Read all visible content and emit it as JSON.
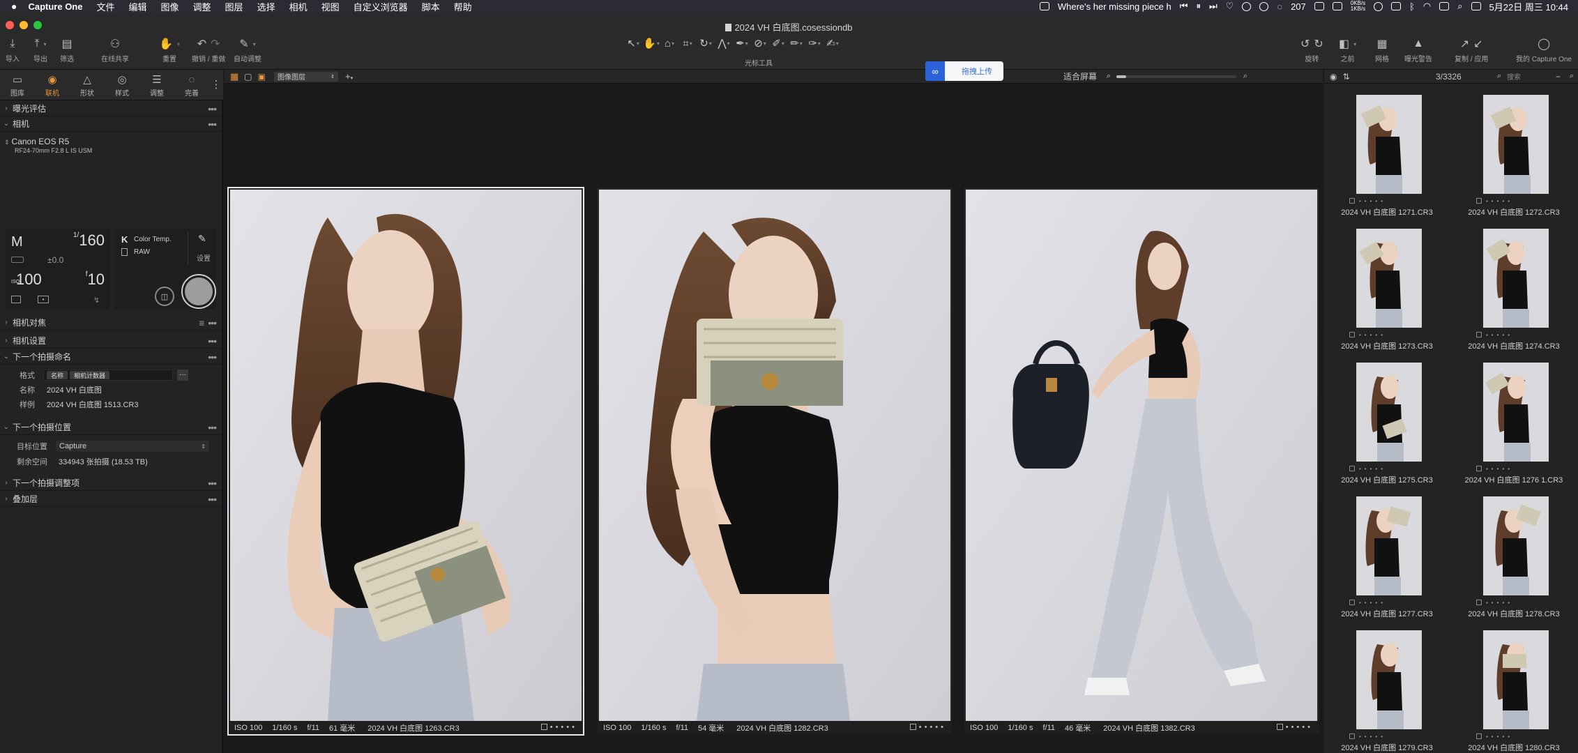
{
  "menubar": {
    "app_name": "Capture One",
    "items": [
      "文件",
      "编辑",
      "图像",
      "调整",
      "图层",
      "选择",
      "相机",
      "视图",
      "自定义浏览器",
      "脚本",
      "帮助"
    ],
    "now_playing": "Where's her missing piece h",
    "notif_count": "207",
    "net_up": "0KB/s",
    "net_down": "1KB/s",
    "datetime": "5月22日 周三  10:44"
  },
  "window": {
    "title": "2024 VH 白底图.cosessiondb"
  },
  "toolbar": {
    "import": "导入",
    "export": "导出",
    "filter": "筛选",
    "share": "在线共享",
    "reset": "重置",
    "undo_redo": "撤销 / 重做",
    "auto_adjust": "自动调整",
    "cursor_tools": "光标工具",
    "rotate": "旋转",
    "before": "之前",
    "grid": "网格",
    "exposure_warning": "曝光警告",
    "copy_apply": "复制 / 应用",
    "my_capture_one": "我的 Capture One"
  },
  "upload": {
    "label": "拖拽上传"
  },
  "left_tabs": [
    {
      "label": "图库",
      "icon": "folder-icon"
    },
    {
      "label": "联机",
      "icon": "camera-icon"
    },
    {
      "label": "形状",
      "icon": "shape-icon"
    },
    {
      "label": "样式",
      "icon": "style-icon"
    },
    {
      "label": "调整",
      "icon": "sliders-icon"
    },
    {
      "label": "完善",
      "icon": "refine-icon"
    }
  ],
  "sections": {
    "exposure_eval": "曝光评估",
    "camera": "相机",
    "camera_focus": "相机对焦",
    "camera_settings": "相机设置",
    "next_capture_naming": "下一个拍摄命名",
    "next_capture_location": "下一个拍摄位置",
    "next_capture_adjustments": "下一个拍摄调整项",
    "overlay": "叠加层"
  },
  "camera": {
    "model": "Canon EOS R5",
    "lens": "RF24-70mm F2.8 L IS USM",
    "mode": "M",
    "shutter_num": "1/",
    "shutter_den": "160",
    "exposure_comp": "±0.0",
    "iso_label": "ISO",
    "iso": "100",
    "aperture_prefix": "f",
    "aperture": "10",
    "wb_letter": "K",
    "wb_label": "Color Temp.",
    "format": "RAW",
    "settings_label": "设置"
  },
  "naming": {
    "format_label": "格式",
    "format_chip1": "名称",
    "format_chip2": "相机计数器",
    "name_label": "名称",
    "name_value": "2024 VH 白底图",
    "sample_label": "样例",
    "sample_value": "2024 VH 白底图 1513.CR3"
  },
  "location": {
    "target_label": "目标位置",
    "target_value": "Capture",
    "space_label": "剩余空间",
    "space_value": "334943 张拍摄  (18.53 TB)"
  },
  "viewer": {
    "layer_select": "图像图层",
    "fit_label": "适合屏幕",
    "variants": [
      {
        "iso": "ISO 100",
        "shutter": "1/160 s",
        "aperture": "f/11",
        "focal": "61 毫米",
        "file": "2024 VH 白底图 1263.CR3"
      },
      {
        "iso": "ISO 100",
        "shutter": "1/160 s",
        "aperture": "f/11",
        "focal": "54 毫米",
        "file": "2024 VH 白底图 1282.CR3"
      },
      {
        "iso": "ISO 100",
        "shutter": "1/160 s",
        "aperture": "f/11",
        "focal": "46 毫米",
        "file": "2024 VH 白底图 1382.CR3"
      }
    ]
  },
  "browser": {
    "counter": "3/3326",
    "search_placeholder": "搜索",
    "thumbnails": [
      "2024 VH 白底图 1271.CR3",
      "2024 VH 白底图 1272.CR3",
      "2024 VH 白底图 1273.CR3",
      "2024 VH 白底图 1274.CR3",
      "2024 VH 白底图 1275.CR3",
      "2024 VH 白底图 1276 1.CR3",
      "2024 VH 白底图 1277.CR3",
      "2024 VH 白底图 1278.CR3",
      "2024 VH 白底图 1279.CR3",
      "2024 VH 白底图 1280.CR3"
    ]
  }
}
